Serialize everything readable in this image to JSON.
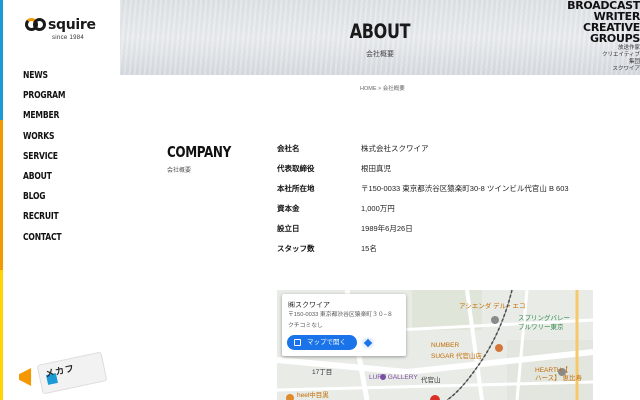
{
  "brand": {
    "logo_text": "squire",
    "logo_sub": "since 1984"
  },
  "nav": {
    "items": [
      "NEWS",
      "PROGRAM",
      "MEMBER",
      "WORKS",
      "SERVICE",
      "ABOUT",
      "BLOG",
      "RECRUIT",
      "CONTACT"
    ]
  },
  "badge": {
    "text": "メカフ"
  },
  "header": {
    "title": "ABOUT",
    "subtitle": "会社概要",
    "tagline_big": [
      "BROADCAST",
      "WRITER",
      "CREATIVE",
      "GROUPS"
    ],
    "tagline_small": [
      "放送作家",
      "クリエイティブ",
      "集団",
      "スクワイア"
    ]
  },
  "breadcrumb": "HOME > 会社概要",
  "company": {
    "title": "COMPANY",
    "subtitle": "会社概要",
    "rows": [
      {
        "key": "会社名",
        "value": "株式会社スクワイア"
      },
      {
        "key": "代表取締役",
        "value": "根田真児"
      },
      {
        "key": "本社所在地",
        "value": "〒150-0033 東京都渋谷区猿楽町30-8 ツインビル代官山 B 603"
      },
      {
        "key": "資本金",
        "value": "1,000万円"
      },
      {
        "key": "設立日",
        "value": "1989年6月26日"
      },
      {
        "key": "スタッフ数",
        "value": "15名"
      }
    ]
  },
  "map": {
    "card_name": "㈱スクワイア",
    "card_addr_1": "〒150-0033 東京都渋谷区猿楽町３０−８",
    "card_addr_2": "クチコミなし",
    "open_button": "マップで開く",
    "labels": [
      "アシエンダ デル・エコ",
      "スプリングバレー",
      "ブルワリー東京",
      "NUMBER",
      "SUGAR 代官山店",
      "HEARTH【",
      "ハース】 恵比寿",
      "LURF GALLERY",
      "代官山",
      "17丁目",
      "heel中目黒"
    ]
  },
  "colors": {
    "accent_blue": "#1c9ad6",
    "accent_orange": "#f39800",
    "accent_yellow": "#ffd400",
    "map_button": "#1a73e8"
  }
}
